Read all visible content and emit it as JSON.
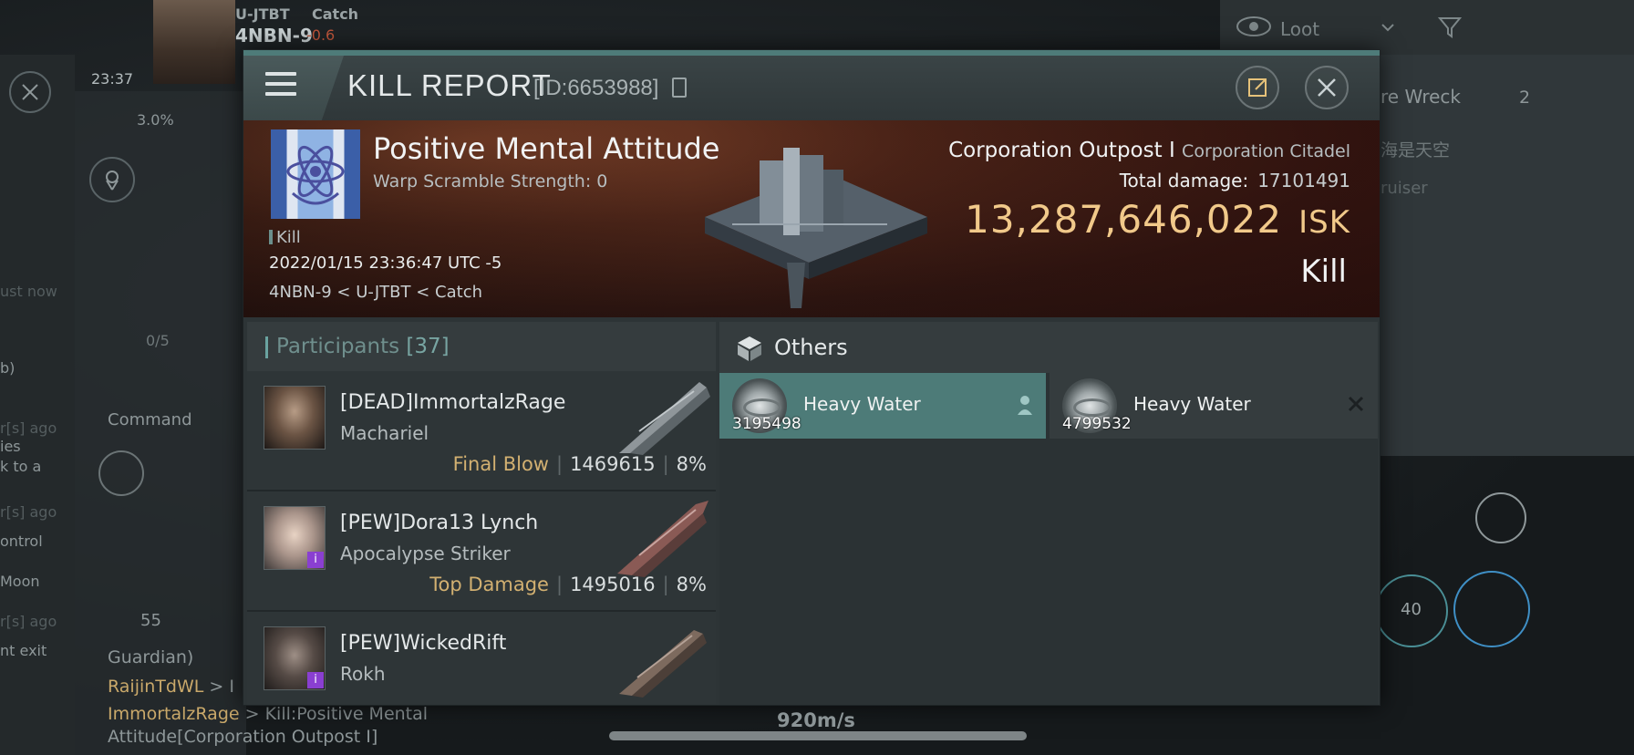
{
  "hud": {
    "system_name": "4NBN-9",
    "security": "-0.6",
    "constellation": "U-JTBT",
    "region": "Catch",
    "clock": "23:37",
    "cargo_percent": "3.0%",
    "slot_count": "0/5",
    "command_label": "Command",
    "local_count": "55",
    "loot_filter": "Loot",
    "right_item_label": "re Wreck",
    "right_item_count": "2",
    "right_chinese": "海是天空",
    "right_small": "ruiser",
    "speed": "920m/s",
    "module_count": "40",
    "chat_lines": [
      {
        "name": "Guardian)",
        "text": ""
      },
      {
        "name": "RaijinTdWL",
        "text": " > I"
      },
      {
        "name": "ImmortalzRage",
        "text": " > Kill:Positive Mental"
      },
      {
        "name": "",
        "text": "Attitude[Corporation Outpost I]"
      }
    ],
    "left_fragments": [
      "ust now",
      "b)",
      "r[s] ago",
      "ies",
      "k to a",
      "r[s] ago",
      "ontrol",
      "Moon",
      "r[s] ago",
      "nt exit"
    ]
  },
  "report": {
    "title": "KILL REPORT",
    "id": "[ID:6653988]",
    "victim": {
      "name": "Positive Mental Attitude",
      "warp": "Warp Scramble Strength: 0",
      "tag": "Kill",
      "date": "2022/01/15 23:36:47 UTC -5",
      "location": "4NBN-9 < U-JTBT < Catch",
      "ship_type": "Corporation Outpost I",
      "ship_class": "Corporation Citadel",
      "total_damage_label": "Total damage:",
      "total_damage": "17101491",
      "isk_value": "13,287,646,022",
      "isk_unit": "ISK",
      "result": "Kill"
    },
    "participants": {
      "label": "Participants",
      "count": "[37]",
      "rows": [
        {
          "name": "[DEAD]ImmortalzRage",
          "ship": "Machariel",
          "role": "Final Blow",
          "damage": "1469615",
          "percent": "8%"
        },
        {
          "name": "[PEW]Dora13 Lynch",
          "ship": "Apocalypse Striker",
          "role": "Top Damage",
          "damage": "1495016",
          "percent": "8%"
        },
        {
          "name": "[PEW]WickedRift",
          "ship": "Rokh",
          "role": "",
          "damage": "",
          "percent": ""
        }
      ]
    },
    "others": {
      "label": "Others",
      "items": [
        {
          "name": "Heavy Water",
          "qty": "3195498"
        },
        {
          "name": "Heavy Water",
          "qty": "4799532"
        }
      ]
    }
  },
  "colors": {
    "accent_teal": "#4d7b78",
    "isk_gold": "#f1c98a",
    "role_gold": "#d2b071"
  }
}
